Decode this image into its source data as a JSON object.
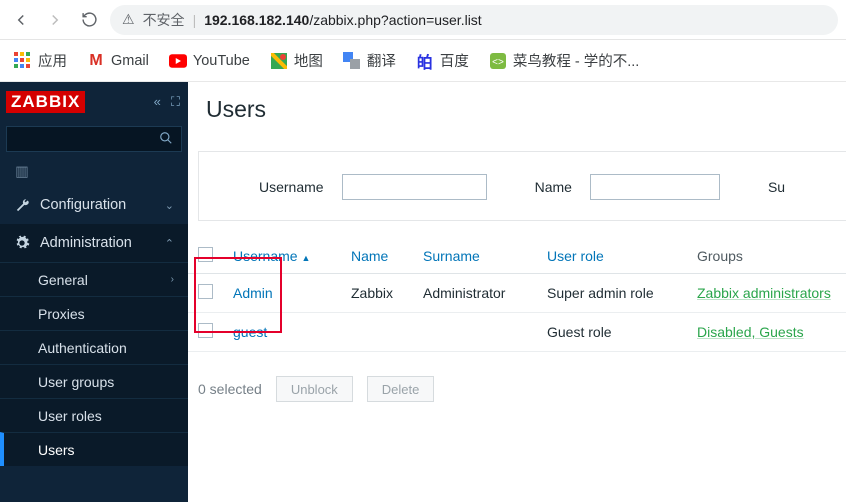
{
  "browser": {
    "insecure_label": "不安全",
    "url_host": "192.168.182.140",
    "url_path": "/zabbix.php?action=user.list"
  },
  "bookmarks": {
    "apps": "应用",
    "gmail": "Gmail",
    "youtube": "YouTube",
    "maps": "地图",
    "translate": "翻译",
    "baidu": "百度",
    "runoob": "菜鸟教程 - 学的不..."
  },
  "sidebar": {
    "logo": "ZABBIX",
    "reports": "Reports",
    "configuration": "Configuration",
    "administration": "Administration",
    "subs": {
      "general": "General",
      "proxies": "Proxies",
      "authentication": "Authentication",
      "user_groups": "User groups",
      "user_roles": "User roles",
      "users": "Users"
    }
  },
  "page": {
    "title": "Users",
    "filter": {
      "username_label": "Username",
      "username_value": "",
      "name_label": "Name",
      "name_value": "",
      "surname_label": "Su"
    },
    "columns": {
      "username": "Username",
      "name": "Name",
      "surname": "Surname",
      "user_role": "User role",
      "groups": "Groups"
    },
    "rows": [
      {
        "username": "Admin",
        "name": "Zabbix",
        "surname": "Administrator",
        "role": "Super admin role",
        "groups": "Zabbix administrators"
      },
      {
        "username": "guest",
        "name": "",
        "surname": "",
        "role": "Guest role",
        "groups": "Disabled, Guests"
      }
    ],
    "footer": {
      "selected": "0 selected",
      "unblock": "Unblock",
      "delete": "Delete"
    }
  }
}
